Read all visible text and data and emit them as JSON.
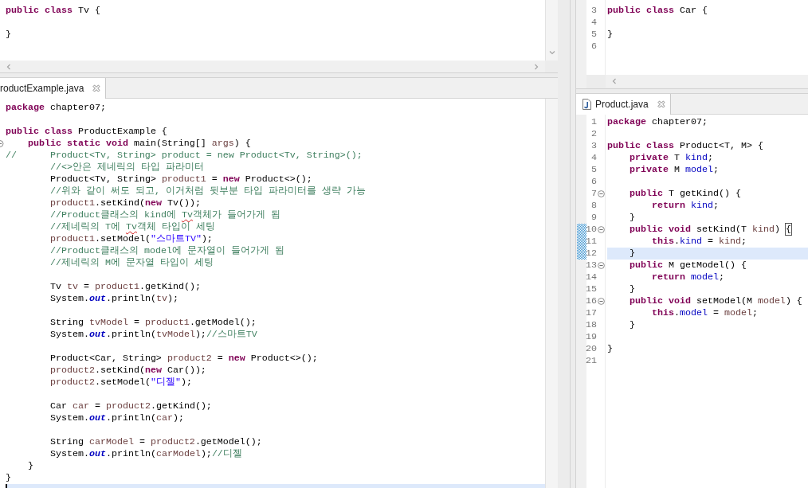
{
  "editor_top_left": {
    "lines": [
      {
        "parts": [
          {
            "text": "public class",
            "kind": "keyword"
          },
          {
            "text": " Tv {",
            "kind": "plain"
          }
        ],
        "fold": false,
        "current": false
      },
      {
        "fold": false,
        "current": false
      },
      {
        "parts": [
          {
            "text": "}",
            "kind": "plain"
          }
        ],
        "fold": false,
        "current": false
      }
    ]
  },
  "editor_bottom_left": {
    "tab": {
      "label": "roductExample.java",
      "selected": true,
      "file_icon": false
    },
    "focused": true,
    "lines": [
      {
        "parts": [
          {
            "text": "package",
            "kind": "keyword"
          },
          {
            "text": " chapter07;",
            "kind": "plain"
          }
        ],
        "fold": false,
        "current": false
      },
      {
        "fold": false,
        "current": false
      },
      {
        "parts": [
          {
            "text": "public class",
            "kind": "keyword"
          },
          {
            "text": " ProductExample {",
            "kind": "plain"
          }
        ],
        "fold": false,
        "current": false
      },
      {
        "parts": [
          {
            "text": "    public static void",
            "kind": "keyword"
          },
          {
            "text": " main(String[] ",
            "kind": "plain"
          },
          {
            "text": "args",
            "kind": "local"
          },
          {
            "text": ") {",
            "kind": "plain"
          }
        ],
        "fold": true,
        "current": false
      },
      {
        "parts": [
          {
            "text": "//      Product<Tv, String> product = new Product<Tv, String>();",
            "kind": "comment"
          }
        ],
        "fold": false,
        "current": false
      },
      {
        "parts": [
          {
            "text": "        //<>안은 제네릭의 타입 파라미터",
            "kind": "comment"
          }
        ],
        "fold": false,
        "current": false
      },
      {
        "parts": [
          {
            "text": "        Product<Tv, String> ",
            "kind": "plain"
          },
          {
            "text": "product1",
            "kind": "local"
          },
          {
            "text": " = ",
            "kind": "plain"
          },
          {
            "text": "new",
            "kind": "keyword"
          },
          {
            "text": " Product<>();",
            "kind": "plain"
          }
        ],
        "fold": false,
        "current": false
      },
      {
        "parts": [
          {
            "text": "        //위와 같이 써도 되고, 이거처럼 뒷부분 타입 파라미터를 생략 가능",
            "kind": "comment"
          }
        ],
        "fold": false,
        "current": false
      },
      {
        "parts": [
          {
            "text": "        product1",
            "kind": "local"
          },
          {
            "text": ".setKind(",
            "kind": "plain"
          },
          {
            "text": "new",
            "kind": "keyword"
          },
          {
            "text": " Tv());",
            "kind": "plain"
          }
        ],
        "fold": false,
        "current": false
      },
      {
        "parts": [
          {
            "text": "        //Product클래스의 kind에 ",
            "kind": "comment"
          },
          {
            "text": "Tv",
            "kind": "spelling"
          },
          {
            "text": "객체가 들어가게 됨",
            "kind": "comment"
          }
        ],
        "fold": false,
        "current": false
      },
      {
        "parts": [
          {
            "text": "        //제네릭의 T에 ",
            "kind": "comment"
          },
          {
            "text": "Tv",
            "kind": "spelling"
          },
          {
            "text": "객체 타입이 세팅",
            "kind": "comment"
          }
        ],
        "fold": false,
        "current": false
      },
      {
        "parts": [
          {
            "text": "        product1",
            "kind": "local"
          },
          {
            "text": ".setModel(",
            "kind": "plain"
          },
          {
            "text": "\"스마트TV\"",
            "kind": "string"
          },
          {
            "text": ");",
            "kind": "plain"
          }
        ],
        "fold": false,
        "current": false
      },
      {
        "parts": [
          {
            "text": "        //Product클래스의 model에 문자열이 들어가게 됨",
            "kind": "comment"
          }
        ],
        "fold": false,
        "current": false
      },
      {
        "parts": [
          {
            "text": "        //제네릭의 M에 문자열 타입이 세팅",
            "kind": "comment"
          }
        ],
        "fold": false,
        "current": false
      },
      {
        "fold": false,
        "current": false
      },
      {
        "parts": [
          {
            "text": "        Tv ",
            "kind": "plain"
          },
          {
            "text": "tv",
            "kind": "local"
          },
          {
            "text": " = ",
            "kind": "plain"
          },
          {
            "text": "product1",
            "kind": "local"
          },
          {
            "text": ".getKind();",
            "kind": "plain"
          }
        ],
        "fold": false,
        "current": false
      },
      {
        "parts": [
          {
            "text": "        System.",
            "kind": "plain"
          },
          {
            "text": "out",
            "kind": "static_field"
          },
          {
            "text": ".println(",
            "kind": "plain"
          },
          {
            "text": "tv",
            "kind": "local"
          },
          {
            "text": ");",
            "kind": "plain"
          }
        ],
        "fold": false,
        "current": false
      },
      {
        "fold": false,
        "current": false
      },
      {
        "parts": [
          {
            "text": "        String ",
            "kind": "plain"
          },
          {
            "text": "tvModel",
            "kind": "local"
          },
          {
            "text": " = ",
            "kind": "plain"
          },
          {
            "text": "product1",
            "kind": "local"
          },
          {
            "text": ".getModel();",
            "kind": "plain"
          }
        ],
        "fold": false,
        "current": false
      },
      {
        "parts": [
          {
            "text": "        System.",
            "kind": "plain"
          },
          {
            "text": "out",
            "kind": "static_field"
          },
          {
            "text": ".println(",
            "kind": "plain"
          },
          {
            "text": "tvModel",
            "kind": "local"
          },
          {
            "text": ");",
            "kind": "plain"
          },
          {
            "text": "//스마트TV",
            "kind": "comment"
          }
        ],
        "fold": false,
        "current": false
      },
      {
        "fold": false,
        "current": false
      },
      {
        "parts": [
          {
            "text": "        Product<Car, String> ",
            "kind": "plain"
          },
          {
            "text": "product2",
            "kind": "local"
          },
          {
            "text": " = ",
            "kind": "plain"
          },
          {
            "text": "new",
            "kind": "keyword"
          },
          {
            "text": " Product<>();",
            "kind": "plain"
          }
        ],
        "fold": false,
        "current": false
      },
      {
        "parts": [
          {
            "text": "        product2",
            "kind": "local"
          },
          {
            "text": ".setKind(",
            "kind": "plain"
          },
          {
            "text": "new",
            "kind": "keyword"
          },
          {
            "text": " Car());",
            "kind": "plain"
          }
        ],
        "fold": false,
        "current": false
      },
      {
        "parts": [
          {
            "text": "        product2",
            "kind": "local"
          },
          {
            "text": ".setModel(",
            "kind": "plain"
          },
          {
            "text": "\"디젤\"",
            "kind": "string"
          },
          {
            "text": ");",
            "kind": "plain"
          }
        ],
        "fold": false,
        "current": false
      },
      {
        "fold": false,
        "current": false
      },
      {
        "parts": [
          {
            "text": "        Car ",
            "kind": "plain"
          },
          {
            "text": "car",
            "kind": "local"
          },
          {
            "text": " = ",
            "kind": "plain"
          },
          {
            "text": "product2",
            "kind": "local"
          },
          {
            "text": ".getKind();",
            "kind": "plain"
          }
        ],
        "fold": false,
        "current": false
      },
      {
        "parts": [
          {
            "text": "        System.",
            "kind": "plain"
          },
          {
            "text": "out",
            "kind": "static_field"
          },
          {
            "text": ".println(",
            "kind": "plain"
          },
          {
            "text": "car",
            "kind": "local"
          },
          {
            "text": ");",
            "kind": "plain"
          }
        ],
        "fold": false,
        "current": false
      },
      {
        "fold": false,
        "current": false
      },
      {
        "parts": [
          {
            "text": "        String ",
            "kind": "plain"
          },
          {
            "text": "carModel",
            "kind": "local"
          },
          {
            "text": " = ",
            "kind": "plain"
          },
          {
            "text": "product2",
            "kind": "local"
          },
          {
            "text": ".getModel();",
            "kind": "plain"
          }
        ],
        "fold": false,
        "current": false
      },
      {
        "parts": [
          {
            "text": "        System.",
            "kind": "plain"
          },
          {
            "text": "out",
            "kind": "static_field"
          },
          {
            "text": ".println(",
            "kind": "plain"
          },
          {
            "text": "carModel",
            "kind": "local"
          },
          {
            "text": ");",
            "kind": "plain"
          },
          {
            "text": "//디젤",
            "kind": "comment"
          }
        ],
        "fold": false,
        "current": false
      },
      {
        "parts": [
          {
            "text": "    }",
            "kind": "plain"
          }
        ],
        "fold": false,
        "current": false
      },
      {
        "parts": [
          {
            "text": "}",
            "kind": "plain"
          }
        ],
        "fold": false,
        "current": false
      },
      {
        "fold": false,
        "current": true
      }
    ]
  },
  "editor_top_right": {
    "lines": [
      {
        "number": "3",
        "parts": [
          {
            "text": "public class",
            "kind": "keyword"
          },
          {
            "text": " Car {",
            "kind": "plain"
          }
        ],
        "fold": false,
        "current": false,
        "marked": false
      },
      {
        "number": "4",
        "fold": false,
        "current": false,
        "marked": false
      },
      {
        "number": "5",
        "parts": [
          {
            "text": "}",
            "kind": "plain"
          }
        ],
        "fold": false,
        "current": false,
        "marked": false
      },
      {
        "number": "6",
        "fold": false,
        "current": false,
        "marked": false
      }
    ]
  },
  "editor_bottom_right": {
    "tab": {
      "label": "Product.java",
      "selected": true,
      "file_icon": true
    },
    "focused": false,
    "lines": [
      {
        "number": "1",
        "parts": [
          {
            "text": "package",
            "kind": "keyword"
          },
          {
            "text": " chapter07;",
            "kind": "plain"
          }
        ],
        "fold": false,
        "current": false,
        "marked": false
      },
      {
        "number": "2",
        "fold": false,
        "current": false,
        "marked": false
      },
      {
        "number": "3",
        "parts": [
          {
            "text": "public class",
            "kind": "keyword"
          },
          {
            "text": " Product<T, M> {",
            "kind": "plain"
          }
        ],
        "fold": false,
        "current": false,
        "marked": false
      },
      {
        "number": "4",
        "parts": [
          {
            "text": "    private",
            "kind": "keyword"
          },
          {
            "text": " T ",
            "kind": "plain"
          },
          {
            "text": "kind",
            "kind": "field"
          },
          {
            "text": ";",
            "kind": "plain"
          }
        ],
        "fold": false,
        "current": false,
        "marked": false
      },
      {
        "number": "5",
        "parts": [
          {
            "text": "    private",
            "kind": "keyword"
          },
          {
            "text": " M ",
            "kind": "plain"
          },
          {
            "text": "model",
            "kind": "field"
          },
          {
            "text": ";",
            "kind": "plain"
          }
        ],
        "fold": false,
        "current": false,
        "marked": false
      },
      {
        "number": "6",
        "fold": false,
        "current": false,
        "marked": false
      },
      {
        "number": "7",
        "parts": [
          {
            "text": "    public",
            "kind": "keyword"
          },
          {
            "text": " T getKind() {",
            "kind": "plain"
          }
        ],
        "fold": true,
        "current": false,
        "marked": false
      },
      {
        "number": "8",
        "parts": [
          {
            "text": "        return ",
            "kind": "keyword"
          },
          {
            "text": "kind",
            "kind": "field"
          },
          {
            "text": ";",
            "kind": "plain"
          }
        ],
        "fold": false,
        "current": false,
        "marked": false
      },
      {
        "number": "9",
        "parts": [
          {
            "text": "    }",
            "kind": "plain"
          }
        ],
        "fold": false,
        "current": false,
        "marked": false
      },
      {
        "number": "10",
        "parts": [
          {
            "text": "    public void",
            "kind": "keyword"
          },
          {
            "text": " setKind(T ",
            "kind": "plain"
          },
          {
            "text": "kind",
            "kind": "local"
          },
          {
            "text": ") ",
            "kind": "plain"
          },
          {
            "text": "{",
            "kind": "bracket"
          }
        ],
        "fold": true,
        "current": false,
        "marked": true
      },
      {
        "number": "11",
        "parts": [
          {
            "text": "        this",
            "kind": "keyword"
          },
          {
            "text": ".",
            "kind": "plain"
          },
          {
            "text": "kind",
            "kind": "field"
          },
          {
            "text": " = ",
            "kind": "plain"
          },
          {
            "text": "kind",
            "kind": "local"
          },
          {
            "text": ";",
            "kind": "plain"
          }
        ],
        "fold": false,
        "current": false,
        "marked": true
      },
      {
        "number": "12",
        "parts": [
          {
            "text": "    }",
            "kind": "plain"
          }
        ],
        "fold": false,
        "current": true,
        "marked": true
      },
      {
        "number": "13",
        "parts": [
          {
            "text": "    public",
            "kind": "keyword"
          },
          {
            "text": " M getModel() {",
            "kind": "plain"
          }
        ],
        "fold": true,
        "current": false,
        "marked": false
      },
      {
        "number": "14",
        "parts": [
          {
            "text": "        return ",
            "kind": "keyword"
          },
          {
            "text": "model",
            "kind": "field"
          },
          {
            "text": ";",
            "kind": "plain"
          }
        ],
        "fold": false,
        "current": false,
        "marked": false
      },
      {
        "number": "15",
        "parts": [
          {
            "text": "    }",
            "kind": "plain"
          }
        ],
        "fold": false,
        "current": false,
        "marked": false
      },
      {
        "number": "16",
        "parts": [
          {
            "text": "    public void",
            "kind": "keyword"
          },
          {
            "text": " setModel(M ",
            "kind": "plain"
          },
          {
            "text": "model",
            "kind": "local"
          },
          {
            "text": ") {",
            "kind": "plain"
          }
        ],
        "fold": true,
        "current": false,
        "marked": false
      },
      {
        "number": "17",
        "parts": [
          {
            "text": "        this",
            "kind": "keyword"
          },
          {
            "text": ".",
            "kind": "plain"
          },
          {
            "text": "model",
            "kind": "field"
          },
          {
            "text": " = ",
            "kind": "plain"
          },
          {
            "text": "model",
            "kind": "local"
          },
          {
            "text": ";",
            "kind": "plain"
          }
        ],
        "fold": false,
        "current": false,
        "marked": false
      },
      {
        "number": "18",
        "parts": [
          {
            "text": "    }",
            "kind": "plain"
          }
        ],
        "fold": false,
        "current": false,
        "marked": false
      },
      {
        "number": "19",
        "fold": false,
        "current": false,
        "marked": false
      },
      {
        "number": "20",
        "parts": [
          {
            "text": "}",
            "kind": "plain"
          }
        ],
        "fold": false,
        "current": false,
        "marked": false
      },
      {
        "number": "21",
        "fold": false,
        "current": false,
        "marked": false
      }
    ]
  }
}
